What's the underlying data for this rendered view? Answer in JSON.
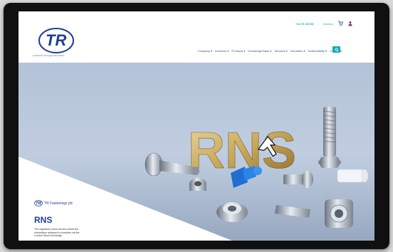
{
  "header": {
    "logo_tagline": "perfection through innovation",
    "phone": "+44 78 48 000",
    "login_label": "Investor",
    "nav": [
      "Company",
      "Investors",
      "Products",
      "Knowledge Base",
      "Services",
      "Industries",
      "Sustainability",
      "Contact"
    ]
  },
  "hero": {
    "rns_sculpture_text": "RNS",
    "card": {
      "brand": "TR Fastenings plc",
      "title": "RNS",
      "description": "The regulatory news service shows the information released to investors via the London Stock Exchange."
    }
  },
  "colors": {
    "brand_navy": "#1f3f8f",
    "accent_teal": "#18a8bd",
    "gold": "#c8a85a",
    "cursor": "#ffffff"
  }
}
